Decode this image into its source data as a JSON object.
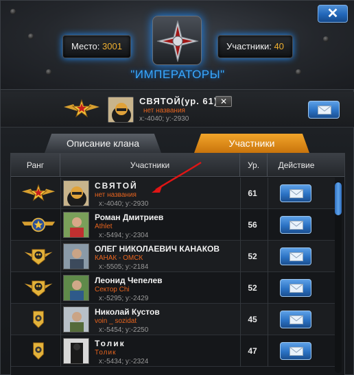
{
  "header": {
    "place_label": "Место:",
    "place_value": "3001",
    "members_label": "Участники:",
    "members_value": "40",
    "clan_name": "\"ИМПЕРАТОРЫ\"",
    "close_label": "✕"
  },
  "leader": {
    "name": "СВЯТОЙ(ур. 61)",
    "subtitle": "нет названия",
    "coords": "x:-4040; y:-2930",
    "remove_label": "✕"
  },
  "tabs": [
    {
      "label": "Описание клана"
    },
    {
      "label": "Участники"
    }
  ],
  "table": {
    "headers": [
      "Ранг",
      "Участники",
      "Ур.",
      "Действие"
    ],
    "rows": [
      {
        "name": "СВЯТОЙ",
        "subtitle": "нет названия",
        "coords": "x:-4040; y:-2930",
        "level": "61",
        "rank": "star-rank-icon"
      },
      {
        "name": "Роман Дмитриев",
        "subtitle": "Athlet",
        "coords": "x:-5494; y:-2304",
        "level": "56",
        "rank": "winged-star-rank-icon"
      },
      {
        "name": "ОЛЕГ НИКОЛАЕВИЧ КАНАКОВ",
        "subtitle": "КАНАК - ОМСК",
        "coords": "x:-5505; y:-2184",
        "level": "52",
        "rank": "skull-rank-icon"
      },
      {
        "name": "Леонид Чепелев",
        "subtitle": "Сектор Chi",
        "coords": "x:-5295; y:-2429",
        "level": "52",
        "rank": "skull-rank-icon"
      },
      {
        "name": "Николай Кустов",
        "subtitle": "voin _ sozidat",
        "coords": "x:-5454; y:-2250",
        "level": "45",
        "rank": "shield-rank-icon"
      },
      {
        "name": "Толик",
        "subtitle": "Толик",
        "coords": "x:-5434; y:-2324",
        "level": "47",
        "rank": "shield-rank-icon"
      }
    ]
  },
  "colors": {
    "accent_blue": "#39a8ff",
    "accent_orange": "#f0b030",
    "subtitle_orange": "#e8641e",
    "annotation_red": "#e01515"
  }
}
